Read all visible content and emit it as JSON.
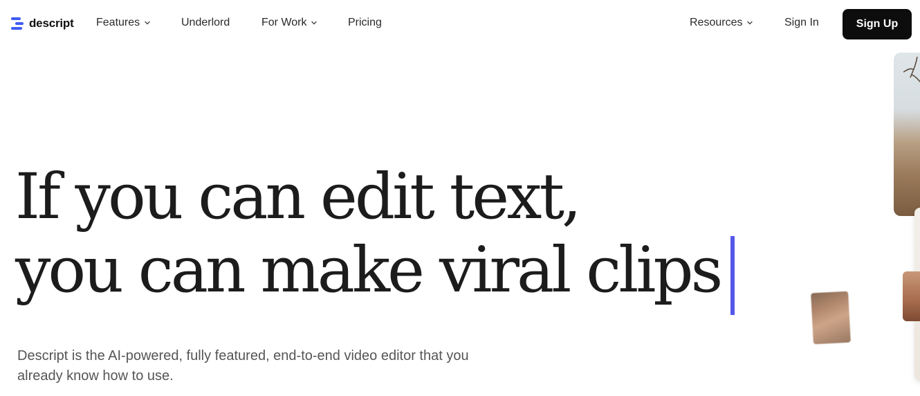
{
  "brand": {
    "name": "descript",
    "icon": "descript-logo-icon",
    "accent_color": "#3e5cf5"
  },
  "nav": {
    "items": [
      {
        "label": "Features",
        "has_dropdown": true
      },
      {
        "label": "Underlord",
        "has_dropdown": false
      },
      {
        "label": "For Work",
        "has_dropdown": true
      },
      {
        "label": "Pricing",
        "has_dropdown": false
      }
    ],
    "right_items": [
      {
        "label": "Resources",
        "has_dropdown": true
      },
      {
        "label": "Sign In",
        "has_dropdown": false
      }
    ],
    "cta_label": "Sign Up"
  },
  "hero": {
    "headline_line1": "If you can edit text,",
    "headline_line2": "you can make viral clips",
    "caret_color": "#5558e8",
    "subtitle": "Descript is the AI-powered, fully featured, end-to-end video editor that you already know how to use."
  },
  "media": {
    "cards": [
      "desert-photo-card",
      "side-card",
      "portrait-card",
      "face-thumbnail"
    ]
  }
}
